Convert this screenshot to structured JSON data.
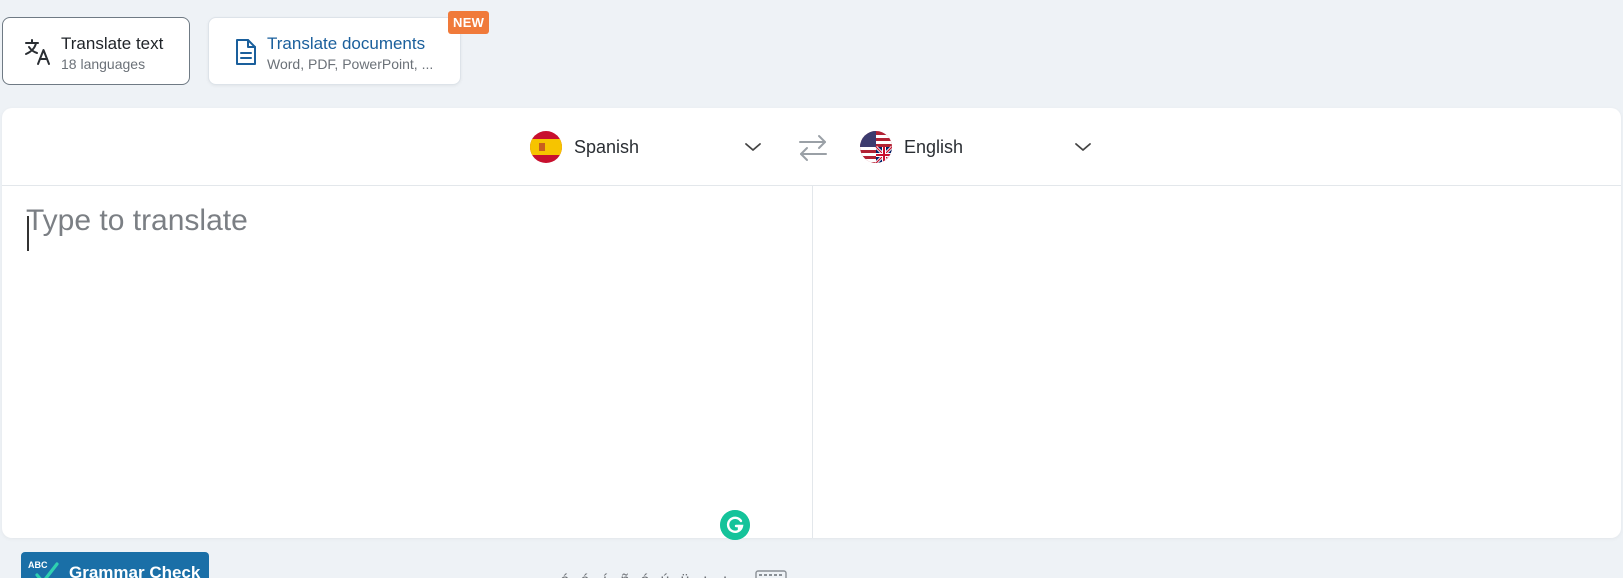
{
  "mode_tabs": {
    "text": {
      "title": "Translate text",
      "subtitle": "18 languages",
      "icon": "translate-icon"
    },
    "documents": {
      "title": "Translate documents",
      "subtitle": "Word, PDF, PowerPoint, ...",
      "icon": "document-icon",
      "badge": "NEW"
    }
  },
  "languages": {
    "source": {
      "name": "Spanish",
      "flag": "spain-flag-icon"
    },
    "target": {
      "name": "English",
      "flag": "uk-us-flag-icon"
    },
    "swap_icon": "swap-arrows-icon"
  },
  "source": {
    "placeholder": "Type to translate",
    "value": ""
  },
  "grammar_check": {
    "label": "Grammar Check",
    "icon_text": "ABC"
  },
  "special_characters": [
    "á",
    "é",
    "í",
    "ñ",
    "ó",
    "ú",
    "ü",
    "¿",
    "¡"
  ],
  "colors": {
    "accent_blue": "#1a6fa7",
    "badge_orange": "#f07a3a",
    "grammarly_green": "#15c39a",
    "page_bg": "#eef2f6"
  }
}
